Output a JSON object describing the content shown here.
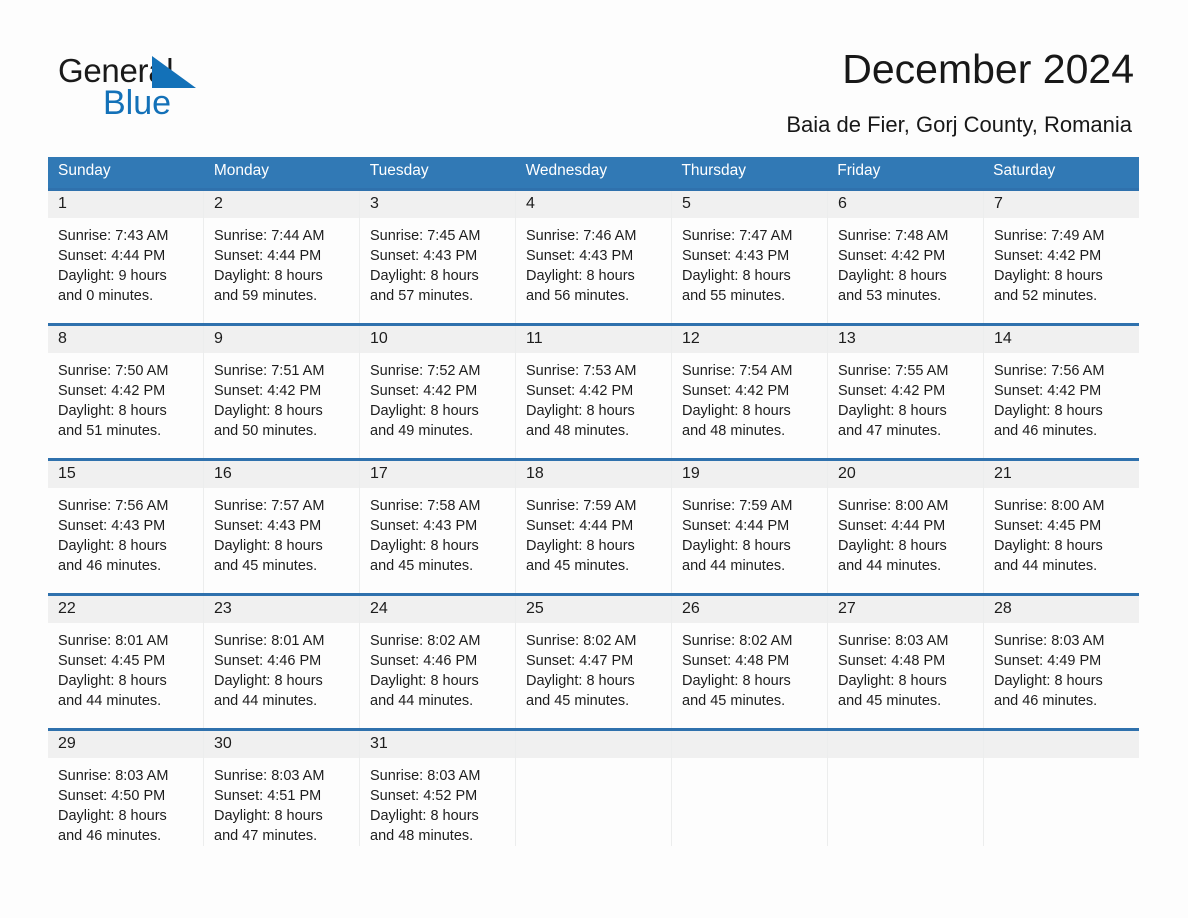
{
  "brand": {
    "name_part1": "General",
    "name_part2": "Blue",
    "accent_color": "#1371b8",
    "triangle_icon": "triangle-icon"
  },
  "header": {
    "title": "December 2024",
    "subtitle": "Baia de Fier, Gorj County, Romania"
  },
  "calendar": {
    "header_bg": "#3179b5",
    "row_divider_color": "#2f71ad",
    "day_strip_bg": "#f0f0f0",
    "weekdays": [
      "Sunday",
      "Monday",
      "Tuesday",
      "Wednesday",
      "Thursday",
      "Friday",
      "Saturday"
    ],
    "weeks": [
      [
        {
          "day": "1",
          "sunrise": "Sunrise: 7:43 AM",
          "sunset": "Sunset: 4:44 PM",
          "daylight_line1": "Daylight: 9 hours",
          "daylight_line2": "and 0 minutes."
        },
        {
          "day": "2",
          "sunrise": "Sunrise: 7:44 AM",
          "sunset": "Sunset: 4:44 PM",
          "daylight_line1": "Daylight: 8 hours",
          "daylight_line2": "and 59 minutes."
        },
        {
          "day": "3",
          "sunrise": "Sunrise: 7:45 AM",
          "sunset": "Sunset: 4:43 PM",
          "daylight_line1": "Daylight: 8 hours",
          "daylight_line2": "and 57 minutes."
        },
        {
          "day": "4",
          "sunrise": "Sunrise: 7:46 AM",
          "sunset": "Sunset: 4:43 PM",
          "daylight_line1": "Daylight: 8 hours",
          "daylight_line2": "and 56 minutes."
        },
        {
          "day": "5",
          "sunrise": "Sunrise: 7:47 AM",
          "sunset": "Sunset: 4:43 PM",
          "daylight_line1": "Daylight: 8 hours",
          "daylight_line2": "and 55 minutes."
        },
        {
          "day": "6",
          "sunrise": "Sunrise: 7:48 AM",
          "sunset": "Sunset: 4:42 PM",
          "daylight_line1": "Daylight: 8 hours",
          "daylight_line2": "and 53 minutes."
        },
        {
          "day": "7",
          "sunrise": "Sunrise: 7:49 AM",
          "sunset": "Sunset: 4:42 PM",
          "daylight_line1": "Daylight: 8 hours",
          "daylight_line2": "and 52 minutes."
        }
      ],
      [
        {
          "day": "8",
          "sunrise": "Sunrise: 7:50 AM",
          "sunset": "Sunset: 4:42 PM",
          "daylight_line1": "Daylight: 8 hours",
          "daylight_line2": "and 51 minutes."
        },
        {
          "day": "9",
          "sunrise": "Sunrise: 7:51 AM",
          "sunset": "Sunset: 4:42 PM",
          "daylight_line1": "Daylight: 8 hours",
          "daylight_line2": "and 50 minutes."
        },
        {
          "day": "10",
          "sunrise": "Sunrise: 7:52 AM",
          "sunset": "Sunset: 4:42 PM",
          "daylight_line1": "Daylight: 8 hours",
          "daylight_line2": "and 49 minutes."
        },
        {
          "day": "11",
          "sunrise": "Sunrise: 7:53 AM",
          "sunset": "Sunset: 4:42 PM",
          "daylight_line1": "Daylight: 8 hours",
          "daylight_line2": "and 48 minutes."
        },
        {
          "day": "12",
          "sunrise": "Sunrise: 7:54 AM",
          "sunset": "Sunset: 4:42 PM",
          "daylight_line1": "Daylight: 8 hours",
          "daylight_line2": "and 48 minutes."
        },
        {
          "day": "13",
          "sunrise": "Sunrise: 7:55 AM",
          "sunset": "Sunset: 4:42 PM",
          "daylight_line1": "Daylight: 8 hours",
          "daylight_line2": "and 47 minutes."
        },
        {
          "day": "14",
          "sunrise": "Sunrise: 7:56 AM",
          "sunset": "Sunset: 4:42 PM",
          "daylight_line1": "Daylight: 8 hours",
          "daylight_line2": "and 46 minutes."
        }
      ],
      [
        {
          "day": "15",
          "sunrise": "Sunrise: 7:56 AM",
          "sunset": "Sunset: 4:43 PM",
          "daylight_line1": "Daylight: 8 hours",
          "daylight_line2": "and 46 minutes."
        },
        {
          "day": "16",
          "sunrise": "Sunrise: 7:57 AM",
          "sunset": "Sunset: 4:43 PM",
          "daylight_line1": "Daylight: 8 hours",
          "daylight_line2": "and 45 minutes."
        },
        {
          "day": "17",
          "sunrise": "Sunrise: 7:58 AM",
          "sunset": "Sunset: 4:43 PM",
          "daylight_line1": "Daylight: 8 hours",
          "daylight_line2": "and 45 minutes."
        },
        {
          "day": "18",
          "sunrise": "Sunrise: 7:59 AM",
          "sunset": "Sunset: 4:44 PM",
          "daylight_line1": "Daylight: 8 hours",
          "daylight_line2": "and 45 minutes."
        },
        {
          "day": "19",
          "sunrise": "Sunrise: 7:59 AM",
          "sunset": "Sunset: 4:44 PM",
          "daylight_line1": "Daylight: 8 hours",
          "daylight_line2": "and 44 minutes."
        },
        {
          "day": "20",
          "sunrise": "Sunrise: 8:00 AM",
          "sunset": "Sunset: 4:44 PM",
          "daylight_line1": "Daylight: 8 hours",
          "daylight_line2": "and 44 minutes."
        },
        {
          "day": "21",
          "sunrise": "Sunrise: 8:00 AM",
          "sunset": "Sunset: 4:45 PM",
          "daylight_line1": "Daylight: 8 hours",
          "daylight_line2": "and 44 minutes."
        }
      ],
      [
        {
          "day": "22",
          "sunrise": "Sunrise: 8:01 AM",
          "sunset": "Sunset: 4:45 PM",
          "daylight_line1": "Daylight: 8 hours",
          "daylight_line2": "and 44 minutes."
        },
        {
          "day": "23",
          "sunrise": "Sunrise: 8:01 AM",
          "sunset": "Sunset: 4:46 PM",
          "daylight_line1": "Daylight: 8 hours",
          "daylight_line2": "and 44 minutes."
        },
        {
          "day": "24",
          "sunrise": "Sunrise: 8:02 AM",
          "sunset": "Sunset: 4:46 PM",
          "daylight_line1": "Daylight: 8 hours",
          "daylight_line2": "and 44 minutes."
        },
        {
          "day": "25",
          "sunrise": "Sunrise: 8:02 AM",
          "sunset": "Sunset: 4:47 PM",
          "daylight_line1": "Daylight: 8 hours",
          "daylight_line2": "and 45 minutes."
        },
        {
          "day": "26",
          "sunrise": "Sunrise: 8:02 AM",
          "sunset": "Sunset: 4:48 PM",
          "daylight_line1": "Daylight: 8 hours",
          "daylight_line2": "and 45 minutes."
        },
        {
          "day": "27",
          "sunrise": "Sunrise: 8:03 AM",
          "sunset": "Sunset: 4:48 PM",
          "daylight_line1": "Daylight: 8 hours",
          "daylight_line2": "and 45 minutes."
        },
        {
          "day": "28",
          "sunrise": "Sunrise: 8:03 AM",
          "sunset": "Sunset: 4:49 PM",
          "daylight_line1": "Daylight: 8 hours",
          "daylight_line2": "and 46 minutes."
        }
      ],
      [
        {
          "day": "29",
          "sunrise": "Sunrise: 8:03 AM",
          "sunset": "Sunset: 4:50 PM",
          "daylight_line1": "Daylight: 8 hours",
          "daylight_line2": "and 46 minutes."
        },
        {
          "day": "30",
          "sunrise": "Sunrise: 8:03 AM",
          "sunset": "Sunset: 4:51 PM",
          "daylight_line1": "Daylight: 8 hours",
          "daylight_line2": "and 47 minutes."
        },
        {
          "day": "31",
          "sunrise": "Sunrise: 8:03 AM",
          "sunset": "Sunset: 4:52 PM",
          "daylight_line1": "Daylight: 8 hours",
          "daylight_line2": "and 48 minutes."
        },
        {
          "day": "",
          "sunrise": "",
          "sunset": "",
          "daylight_line1": "",
          "daylight_line2": ""
        },
        {
          "day": "",
          "sunrise": "",
          "sunset": "",
          "daylight_line1": "",
          "daylight_line2": ""
        },
        {
          "day": "",
          "sunrise": "",
          "sunset": "",
          "daylight_line1": "",
          "daylight_line2": ""
        },
        {
          "day": "",
          "sunrise": "",
          "sunset": "",
          "daylight_line1": "",
          "daylight_line2": ""
        }
      ]
    ]
  }
}
